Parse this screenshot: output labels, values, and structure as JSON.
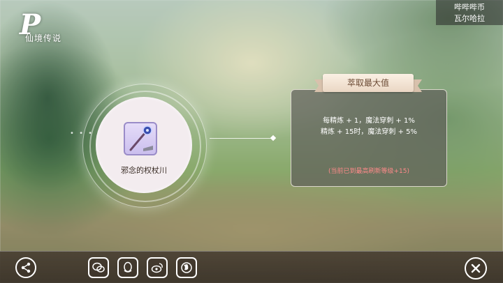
{
  "logo": {
    "letter": "P",
    "text": "仙境传说"
  },
  "server": {
    "line1": "哔哔哔币",
    "line2": "瓦尔哈拉"
  },
  "item": {
    "name": "邪念的权杖川"
  },
  "panel": {
    "title": "萃取最大值",
    "line1": "每精炼 + 1，魔法穿刺 + 1%",
    "line2": "精炼 + 15时，魔法穿刺 + 5%",
    "note": "(当前已到最高刷新等级+15)"
  },
  "colors": {
    "accent_red": "#ff8a8a",
    "panel_border": "#e6e1d7",
    "title_brown": "#6b4a34"
  },
  "icons": [
    "share-icon",
    "wechat-icon",
    "qq-icon",
    "weibo-icon",
    "globe-icon",
    "close-icon"
  ]
}
